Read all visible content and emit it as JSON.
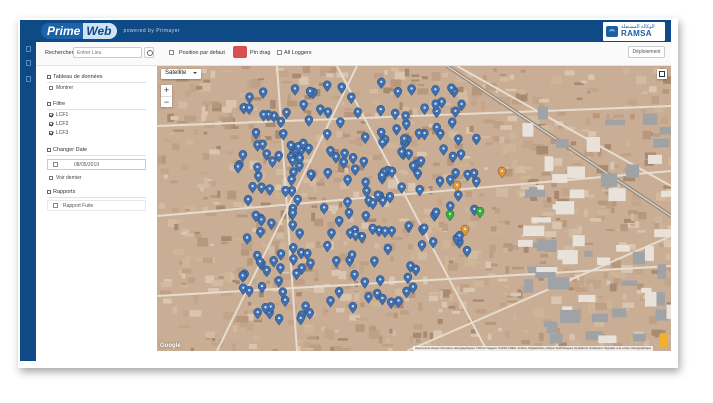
{
  "app": {
    "brand_prime": "Prime",
    "brand_web": "Web",
    "powered_by": "powered by Primayer",
    "org_logo": {
      "arabic": "الوكالة المستقلة",
      "latin": "RAMSA"
    },
    "accent": "#0e4a86"
  },
  "toolbar": {
    "search_label": "Rechercher",
    "search_placeholder": "Entrer Lieu",
    "default_position_label": "Position par defaut",
    "pin_drag_label": "Pin drag",
    "all_loggers_label": "All Loggers",
    "deploy_label": "Déploiement"
  },
  "sidebar": {
    "data_table": {
      "title": "Tableau de données",
      "items": [
        {
          "label": "Montrer",
          "checked": false
        }
      ]
    },
    "filter": {
      "title": "Filtre",
      "items": [
        {
          "label": "LCF1",
          "checked": true
        },
        {
          "label": "LCF2",
          "checked": true
        },
        {
          "label": "LCF3",
          "checked": true
        }
      ]
    },
    "date": {
      "title": "Changer Date",
      "value": "08/05/2019",
      "last_label": "Voir dernier"
    },
    "reports": {
      "title": "Rapports",
      "item_label": "Rapport Fuite"
    }
  },
  "map": {
    "type_selector": "Satellite",
    "zoom_in": "+",
    "zoom_out": "−",
    "google_label": "Google",
    "attribution": "Raccourcis clavier   Données cartographiques ©2019 Imagerie ©2019 CNES / Airbus, DigitalGlobe, Maxar Technologies   Conditions d'utilisation   Signaler une erreur cartographique",
    "marker_colors": {
      "blue": "#3f6fae",
      "green": "#34b233",
      "orange": "#e6962a"
    }
  }
}
